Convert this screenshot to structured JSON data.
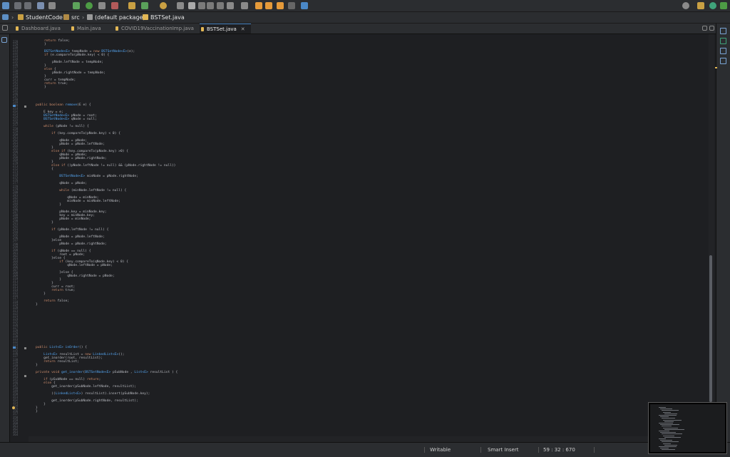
{
  "breadcrumb": {
    "project": "StudentCode",
    "folder": "src",
    "package": "(default package)",
    "file": "BSTSet.java"
  },
  "tabs": [
    {
      "label": "Dashboard.java"
    },
    {
      "label": "Main.java"
    },
    {
      "label": "COVID19VaccinationImp.java"
    },
    {
      "label": "BSTSet.java",
      "close": "✕"
    }
  ],
  "status": {
    "mode": "Writable",
    "insert": "Smart Insert",
    "position": "59 : 32 : 670"
  },
  "colors": {
    "keyword": "#cf8e6d",
    "type": "#56a8f5",
    "literal": "#2aacb8",
    "text": "#bcbec4",
    "accent_tab": "#4a88c7"
  },
  "icons": [
    "new-file-icon",
    "save-icon",
    "debug-icon",
    "run-icon",
    "search-icon",
    "back-icon",
    "forward-icon",
    "perspective-icon",
    "problems-icon"
  ]
}
